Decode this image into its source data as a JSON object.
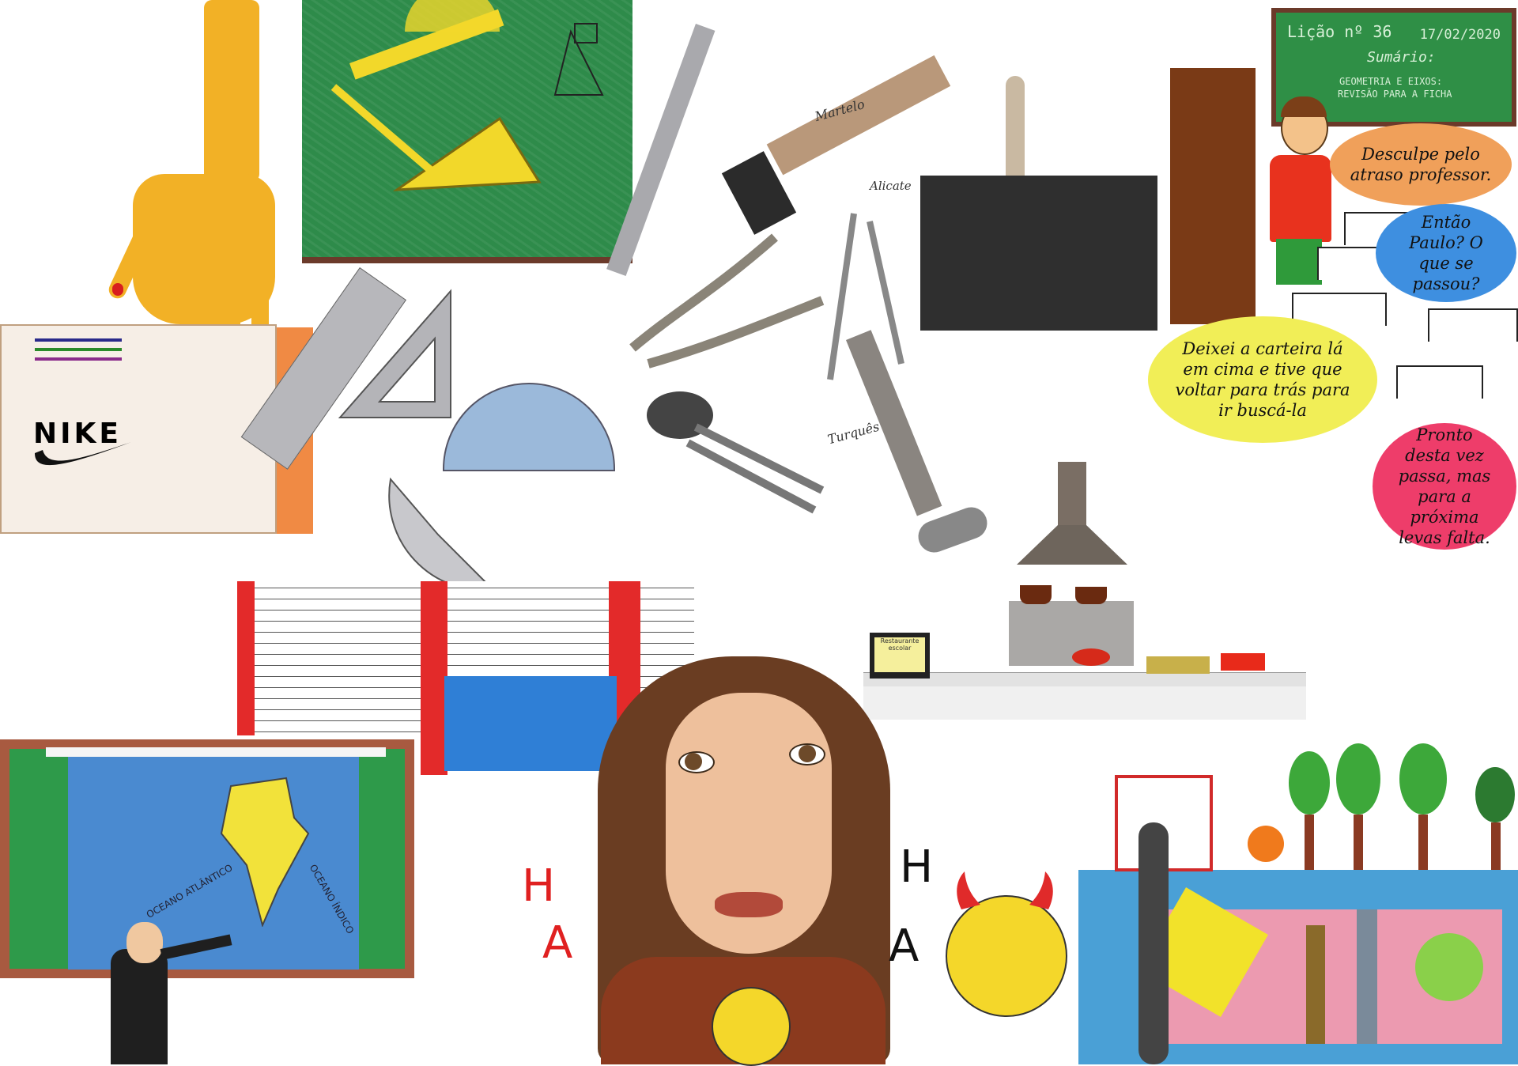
{
  "lesson_board": {
    "lesson": "Lição nº 36",
    "date": "17/02/2020",
    "summary_label": "Sumário:",
    "topic_line1": "GEOMETRIA E EIXOS:",
    "topic_line2": "REVISÃO PARA A FICHA"
  },
  "dialogue": [
    {
      "speaker": "student",
      "text": "Desculpe pelo atraso professor."
    },
    {
      "speaker": "teacher",
      "text": "Então Paulo? O que se passou?"
    },
    {
      "speaker": "student",
      "text": "Deixei a carteira lá em cima e tive que voltar para trás para ir buscá-la"
    },
    {
      "speaker": "teacher",
      "text": "Pronto desta vez passa, mas para a próxima levas falta."
    }
  ],
  "tool_labels": {
    "hammer": "Martelo",
    "pliers": "Alicate",
    "pincers": "Turquês"
  },
  "box_logo": "NIKE",
  "map_labels": {
    "atlantic": "OCEANO ATLÂNTICO",
    "indian": "OCEANO ÍNDICO"
  },
  "laughter": {
    "left": [
      "H",
      "A"
    ],
    "right": [
      "H",
      "A"
    ]
  },
  "kitchen_screen": "Restaurante escolar",
  "colors": {
    "chalkboard": "#2e8b4a",
    "board_frame": "#6b3a2a",
    "bubble_orange": "#f0a05a",
    "bubble_blue": "#3e8fe0",
    "bubble_yellow": "#f1ee57",
    "bubble_pink": "#ee3d6a",
    "ha_left": "#e02020",
    "ha_right": "#111111"
  }
}
